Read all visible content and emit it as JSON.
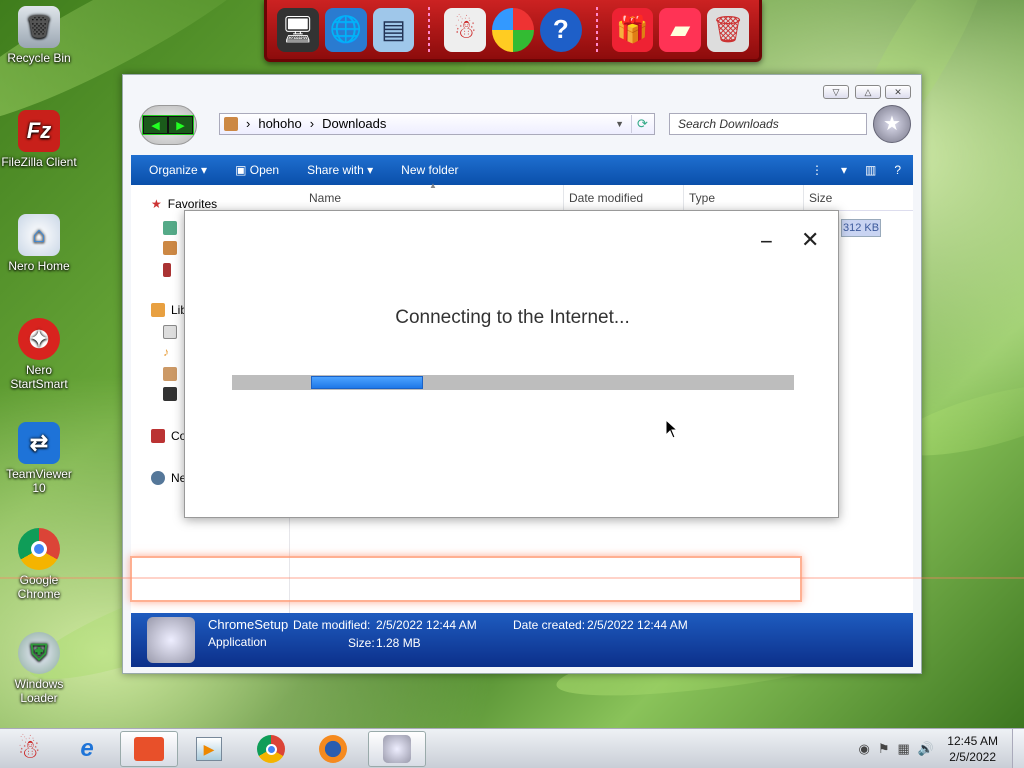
{
  "desktop": {
    "icons": [
      {
        "label": "Recycle Bin",
        "color": "#8d9aa8"
      },
      {
        "label": "FileZilla Client",
        "color": "#c8201a"
      },
      {
        "label": "Nero Home",
        "color": "#3a88d8"
      },
      {
        "label": "Nero StartSmart",
        "color": "#d8231e"
      },
      {
        "label": "TeamViewer 10",
        "color": "#1e73d8"
      },
      {
        "label": "Google Chrome",
        "color": "#e8b320"
      },
      {
        "label": "Windows Loader",
        "color": "#2e9a3a"
      }
    ]
  },
  "dock": {
    "icons": [
      "display-icon",
      "globe-monitor-icon",
      "control-panel-icon",
      "snowman-icon",
      "windows-orb-icon",
      "help-icon",
      "gift-icon",
      "folder-icon",
      "recycle-bin-icon"
    ]
  },
  "explorer": {
    "breadcrumb": [
      "hohoho",
      "Downloads"
    ],
    "search_placeholder": "Search Downloads",
    "toolbar": {
      "organize": "Organize",
      "open": "Open",
      "share_with": "Share with",
      "new_folder": "New folder"
    },
    "sidebar": {
      "favorites": "Favorites",
      "libraries": "Lib",
      "computer": "Co",
      "network": "Ne"
    },
    "columns": [
      "Name",
      "Date modified",
      "Type",
      "Size"
    ],
    "size_chip": "312 KB",
    "details": {
      "file_name": "ChromeSetup",
      "file_type": "Application",
      "date_modified_label": "Date modified:",
      "date_modified": "2/5/2022 12:44 AM",
      "size_label": "Size:",
      "size": "1.28 MB",
      "date_created_label": "Date created:",
      "date_created": "2/5/2022 12:44 AM"
    }
  },
  "dialog": {
    "message": "Connecting to the Internet...",
    "minimize": "−",
    "close": "✕",
    "progress_segment": {
      "start_fraction": 0.14,
      "end_fraction": 0.34
    }
  },
  "taskbar": {
    "time": "12:45 AM",
    "date": "2/5/2022"
  }
}
